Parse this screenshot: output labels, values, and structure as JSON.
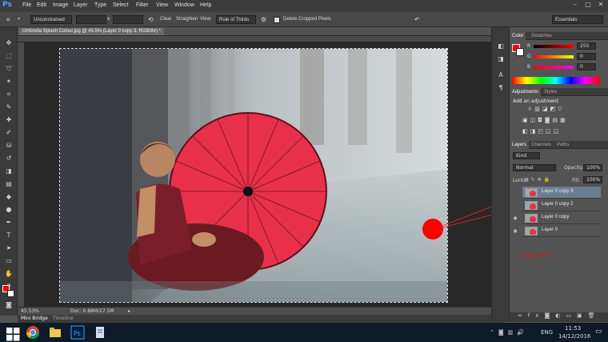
{
  "app": {
    "logo": "Ps"
  },
  "menu": [
    "File",
    "Edit",
    "Image",
    "Layer",
    "Type",
    "Select",
    "Filter",
    "View",
    "Window",
    "Help"
  ],
  "options": {
    "ratio": "Unconstrained",
    "x_sep": "x",
    "clear": "Clear",
    "straighten": "Straighten",
    "view_label": "View:",
    "view_value": "Rule of Thirds",
    "delete_cropped": "Delete Cropped Pixels",
    "workspace": "Essentials"
  },
  "document": {
    "tab": "Umbrella Splash Colour.jpg @ 45.5% (Layer 0 copy 3, RGB/8#) *",
    "zoom": "45.53%",
    "doc_size": "Doc: 6.88M/27.5M",
    "bottom_tabs": [
      "Mini Bridge",
      "Timeline"
    ]
  },
  "color_panel": {
    "tabs": [
      "Color",
      "Swatches"
    ],
    "r_label": "R",
    "g_label": "G",
    "b_label": "B",
    "r": "255",
    "g": "0",
    "b": "0"
  },
  "adjustments": {
    "tabs": [
      "Adjustments",
      "Styles"
    ],
    "title": "Add an adjustment"
  },
  "layers_panel": {
    "tabs": [
      "Layers",
      "Channels",
      "Paths"
    ],
    "kind": "Kind",
    "blend": "Normal",
    "opacity_label": "Opacity:",
    "opacity": "100%",
    "lock_label": "Lock:",
    "fill_label": "Fill:",
    "fill": "100%",
    "layers": [
      "Layer 0 copy 3",
      "Layer 0 copy 2",
      "Layer 0 copy",
      "Layer 0"
    ]
  },
  "annotation": {
    "text": "Drag Here",
    "color": "#e01010"
  },
  "taskbar": {
    "lang": "ENG",
    "time": "11:53",
    "date": "14/12/2016"
  },
  "colors": {
    "accent": "#ff0000",
    "umbrella": "#e8304a",
    "selection": "#6e7c91"
  }
}
